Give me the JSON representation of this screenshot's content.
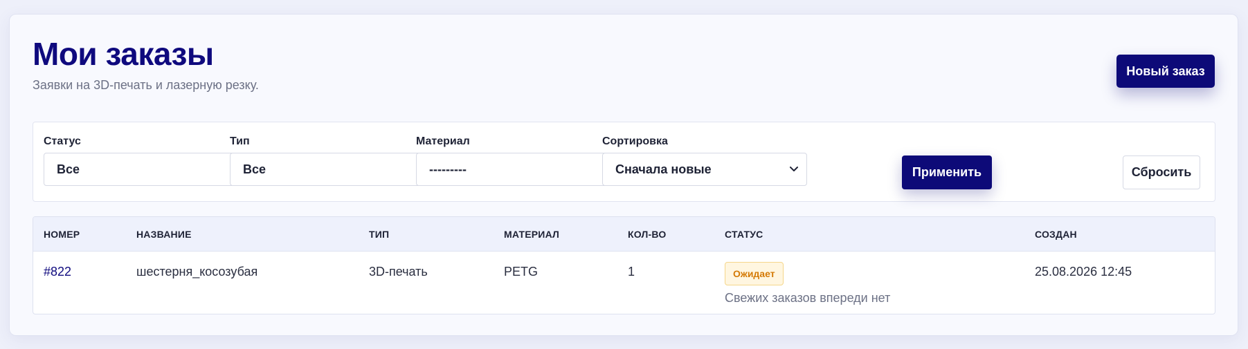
{
  "header": {
    "title": "Мои заказы",
    "subtitle": "Заявки на 3D-печать и лазерную резку.",
    "new_order_label": "Новый заказ"
  },
  "filters": {
    "status": {
      "label": "Статус",
      "value": "Все"
    },
    "type": {
      "label": "Тип",
      "value": "Все"
    },
    "material": {
      "label": "Материал",
      "value": "---------"
    },
    "sort": {
      "label": "Сортировка",
      "value": "Сначала новые"
    },
    "apply_label": "Применить",
    "reset_label": "Сбросить"
  },
  "table": {
    "columns": [
      "Номер",
      "Название",
      "Тип",
      "Материал",
      "Кол-во",
      "Статус",
      "Создан"
    ],
    "rows": [
      {
        "number": "#822",
        "name": "шестерня_косозубая",
        "type": "3D-печать",
        "material": "PETG",
        "qty": "1",
        "status": "Ожидает",
        "status_note": "Свежих заказов впереди нет",
        "created": "25.08.2026 12:45"
      }
    ]
  },
  "colors": {
    "accent": "#0d0a78",
    "badge_text": "#d47a06",
    "badge_bg": "#fff6e0"
  },
  "icons": [
    "chevron-down-icon"
  ]
}
